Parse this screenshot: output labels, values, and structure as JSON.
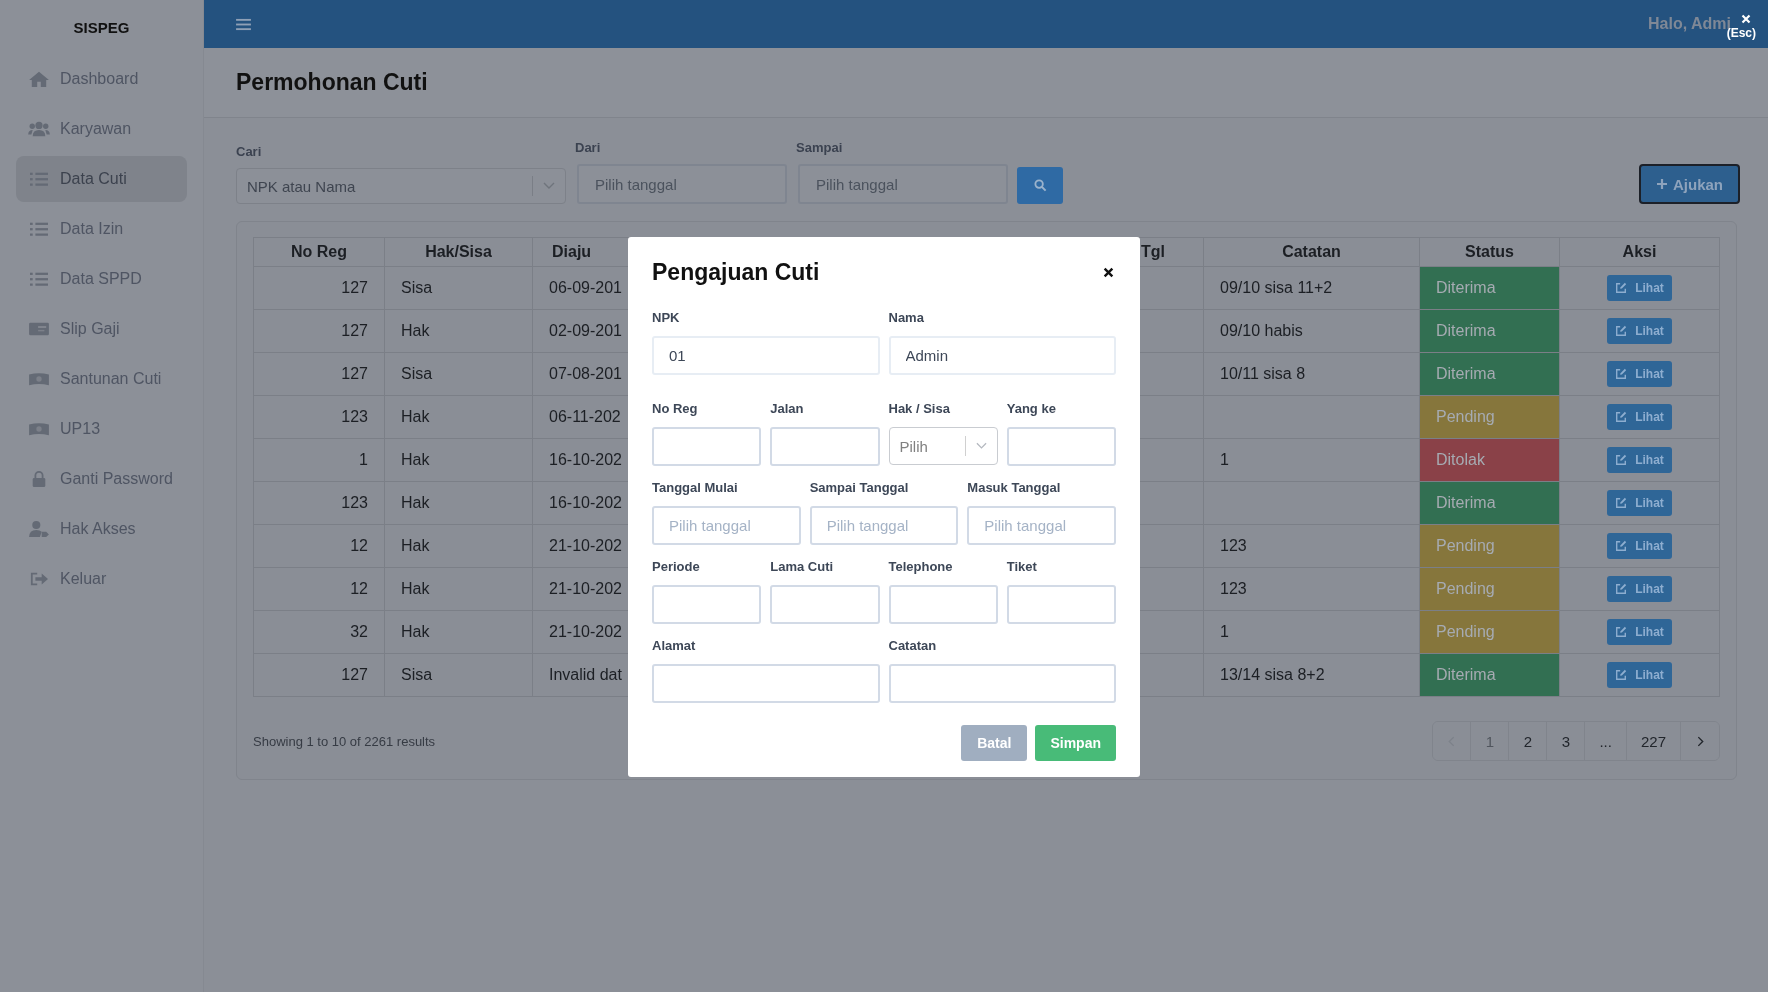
{
  "sidebar": {
    "brand": "SISPEG",
    "items": [
      {
        "label": "Dashboard",
        "selected": false
      },
      {
        "label": "Karyawan",
        "selected": false
      },
      {
        "label": "Data Cuti",
        "selected": true
      },
      {
        "label": "Data Izin",
        "selected": false
      },
      {
        "label": "Data SPPD",
        "selected": false
      },
      {
        "label": "Slip Gaji",
        "selected": false
      },
      {
        "label": "Santunan Cuti",
        "selected": false
      },
      {
        "label": "UP13",
        "selected": false
      },
      {
        "label": "Ganti Password",
        "selected": false
      },
      {
        "label": "Hak Akses",
        "selected": false
      },
      {
        "label": "Keluar",
        "selected": false
      }
    ]
  },
  "topbar": {
    "greeting": "Halo, Admi",
    "close_hint": "(Esc)"
  },
  "page": {
    "title": "Permohonan Cuti"
  },
  "filters": {
    "search": {
      "label": "Cari",
      "placeholder": "NPK atau Nama"
    },
    "from": {
      "label": "Dari",
      "placeholder": "Pilih tanggal"
    },
    "to": {
      "label": "Sampai",
      "placeholder": "Pilih tanggal"
    },
    "add_button": "Ajukan"
  },
  "table": {
    "columns": [
      "No Reg",
      "Hak/Sisa",
      "Diaju",
      "Tgl",
      "Catatan",
      "Status",
      "Aksi"
    ],
    "rows": [
      {
        "no_reg": "127",
        "hak_sisa": "Sisa",
        "submitted": "06-09-201",
        "note": "09/10 sisa 11+2",
        "status": "Diterima",
        "kind": "accepted",
        "action": "Lihat"
      },
      {
        "no_reg": "127",
        "hak_sisa": "Hak",
        "submitted": "02-09-201",
        "note": "09/10 habis",
        "status": "Diterima",
        "kind": "accepted",
        "action": "Lihat"
      },
      {
        "no_reg": "127",
        "hak_sisa": "Sisa",
        "submitted": "07-08-201",
        "note": "10/11 sisa 8",
        "status": "Diterima",
        "kind": "accepted",
        "action": "Lihat"
      },
      {
        "no_reg": "123",
        "hak_sisa": "Hak",
        "submitted": "06-11-202",
        "status": "Pending",
        "kind": "pending",
        "action": "Lihat"
      },
      {
        "no_reg": "1",
        "hak_sisa": "Hak",
        "submitted": "16-10-202",
        "note": "1",
        "status": "Ditolak",
        "kind": "rejected",
        "action": "Lihat"
      },
      {
        "no_reg": "123",
        "hak_sisa": "Hak",
        "submitted": "16-10-202",
        "status": "Diterima",
        "kind": "accepted",
        "action": "Lihat"
      },
      {
        "no_reg": "12",
        "hak_sisa": "Hak",
        "submitted": "21-10-202",
        "note": "123",
        "status": "Pending",
        "kind": "pending",
        "action": "Lihat"
      },
      {
        "no_reg": "12",
        "hak_sisa": "Hak",
        "submitted": "21-10-202",
        "note": "123",
        "status": "Pending",
        "kind": "pending",
        "action": "Lihat"
      },
      {
        "no_reg": "32",
        "hak_sisa": "Hak",
        "submitted": "21-10-202",
        "note": "1",
        "status": "Pending",
        "kind": "pending",
        "action": "Lihat"
      },
      {
        "no_reg": "127",
        "hak_sisa": "Sisa",
        "submitted": "Invalid dat",
        "note": "13/14 sisa 8+2",
        "status": "Diterima",
        "kind": "accepted",
        "action": "Lihat"
      }
    ]
  },
  "summary": "Showing 1 to 10 of 2261 results",
  "pagination": {
    "prev_disabled": true,
    "pages": [
      {
        "label": "1",
        "selected": true
      },
      {
        "label": "2",
        "selected": false
      },
      {
        "label": "3",
        "selected": false
      },
      {
        "label": "...",
        "selected": false
      },
      {
        "label": "227",
        "selected": false
      }
    ]
  },
  "modal": {
    "title": "Pengajuan Cuti",
    "rows": [
      {
        "fields": [
          {
            "label": "NPK",
            "kind": "text",
            "value": "01"
          },
          {
            "label": "Nama",
            "kind": "text",
            "value": "Admin"
          }
        ]
      },
      {
        "fields": [
          {
            "label": "No Reg",
            "kind": "text"
          },
          {
            "label": "Jalan",
            "kind": "text"
          },
          {
            "label": "Hak / Sisa",
            "kind": "select",
            "placeholder": "Pilih"
          },
          {
            "label": "Yang ke",
            "kind": "text"
          }
        ]
      },
      {
        "fields": [
          {
            "label": "Tanggal Mulai",
            "kind": "date",
            "placeholder": "Pilih tanggal"
          },
          {
            "label": "Sampai Tanggal",
            "kind": "date",
            "placeholder": "Pilih tanggal"
          },
          {
            "label": "Masuk Tanggal",
            "kind": "date",
            "placeholder": "Pilih tanggal"
          }
        ]
      },
      {
        "fields": [
          {
            "label": "Periode",
            "kind": "text"
          },
          {
            "label": "Lama Cuti",
            "kind": "text"
          },
          {
            "label": "Telephone",
            "kind": "text"
          },
          {
            "label": "Tiket",
            "kind": "text"
          }
        ]
      },
      {
        "fields": [
          {
            "label": "Alamat",
            "kind": "text"
          },
          {
            "label": "Catatan",
            "kind": "text"
          }
        ]
      }
    ],
    "cancel": "Batal",
    "submit": "Simpan"
  }
}
